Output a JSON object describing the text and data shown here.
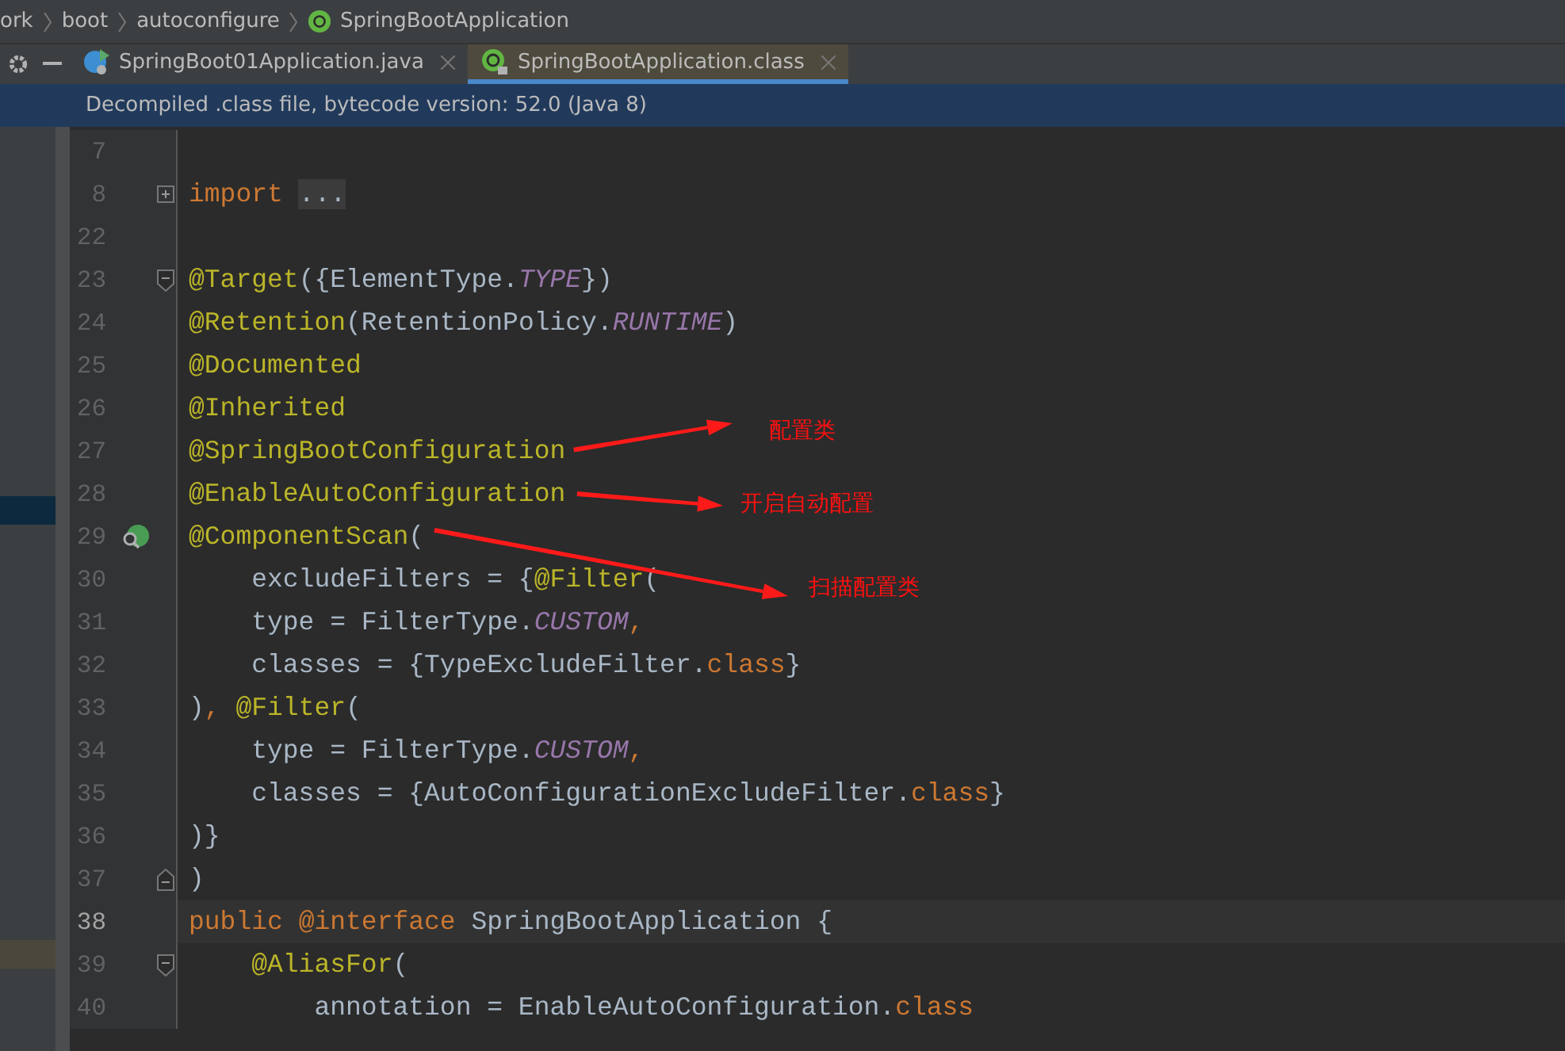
{
  "breadcrumbs": [
    {
      "label": "ork",
      "icon": false
    },
    {
      "label": "boot",
      "icon": false
    },
    {
      "label": "autoconfigure",
      "icon": false
    },
    {
      "label": "SpringBootApplication",
      "icon": true
    }
  ],
  "tabs": [
    {
      "label": "SpringBoot01Application.java",
      "selected": false,
      "kind": "java"
    },
    {
      "label": "SpringBootApplication.class",
      "selected": true,
      "kind": "annotation"
    }
  ],
  "banner": "Decompiled .class file, bytecode version: 52.0 (Java 8)",
  "lines": [
    {
      "number": "7",
      "current": false,
      "gutter_icon": false
    },
    {
      "number": "8",
      "current": false,
      "gutter_icon": false,
      "fold": {
        "kind": "expand"
      },
      "tokens": [
        {
          "kind": "keyword",
          "text": "import"
        },
        {
          "kind": "folded",
          "text": "..."
        }
      ]
    },
    {
      "number": "22",
      "current": false,
      "gutter_icon": false
    },
    {
      "number": "23",
      "current": false,
      "gutter_icon": false,
      "fold": {
        "kind": "start"
      },
      "tokens": [
        {
          "kind": "annotation",
          "text": "@Target"
        },
        {
          "kind": "plain",
          "text": "({ElementType."
        },
        {
          "kind": "constant",
          "text": "TYPE"
        },
        {
          "kind": "plain",
          "text": "})"
        }
      ]
    },
    {
      "number": "24",
      "current": false,
      "gutter_icon": false,
      "tokens": [
        {
          "kind": "annotation",
          "text": "@Retention"
        },
        {
          "kind": "plain",
          "text": "(RetentionPolicy."
        },
        {
          "kind": "constant",
          "text": "RUNTIME"
        },
        {
          "kind": "plain",
          "text": ")"
        }
      ]
    },
    {
      "number": "25",
      "current": false,
      "gutter_icon": false,
      "tokens": [
        {
          "kind": "annotation",
          "text": "@Documented"
        }
      ]
    },
    {
      "number": "26",
      "current": false,
      "gutter_icon": false,
      "tokens": [
        {
          "kind": "annotation",
          "text": "@Inherited"
        }
      ]
    },
    {
      "number": "27",
      "current": false,
      "gutter_icon": false,
      "tokens": [
        {
          "kind": "annotation",
          "text": "@SpringBootConfiguration"
        }
      ]
    },
    {
      "number": "28",
      "current": false,
      "gutter_icon": false,
      "tokens": [
        {
          "kind": "annotation",
          "text": "@EnableAutoConfiguration"
        }
      ]
    },
    {
      "number": "29",
      "current": false,
      "gutter_icon": true,
      "tokens": [
        {
          "kind": "annotation",
          "text": "@ComponentScan"
        },
        {
          "kind": "plain",
          "text": "("
        }
      ]
    },
    {
      "number": "30",
      "current": false,
      "gutter_icon": false,
      "tokens": [
        {
          "kind": "plain",
          "text": "    excludeFilters = {"
        },
        {
          "kind": "annotation",
          "text": "@Filter"
        },
        {
          "kind": "plain",
          "text": "("
        }
      ]
    },
    {
      "number": "31",
      "current": false,
      "gutter_icon": false,
      "tokens": [
        {
          "kind": "plain",
          "text": "    type = FilterType."
        },
        {
          "kind": "constant",
          "text": "CUSTOM"
        },
        {
          "kind": "keyword",
          "text": ","
        }
      ]
    },
    {
      "number": "32",
      "current": false,
      "gutter_icon": false,
      "tokens": [
        {
          "kind": "plain",
          "text": "    classes = {TypeExcludeFilter."
        },
        {
          "kind": "keyword",
          "text": "class"
        },
        {
          "kind": "plain",
          "text": "}"
        }
      ]
    },
    {
      "number": "33",
      "current": false,
      "gutter_icon": false,
      "tokens": [
        {
          "kind": "plain",
          "text": ")"
        },
        {
          "kind": "keyword",
          "text": ", "
        },
        {
          "kind": "annotation",
          "text": "@Filter"
        },
        {
          "kind": "plain",
          "text": "("
        }
      ]
    },
    {
      "number": "34",
      "current": false,
      "gutter_icon": false,
      "tokens": [
        {
          "kind": "plain",
          "text": "    type = FilterType."
        },
        {
          "kind": "constant",
          "text": "CUSTOM"
        },
        {
          "kind": "keyword",
          "text": ","
        }
      ]
    },
    {
      "number": "35",
      "current": false,
      "gutter_icon": false,
      "tokens": [
        {
          "kind": "plain",
          "text": "    classes = {AutoConfigurationExcludeFilter."
        },
        {
          "kind": "keyword",
          "text": "class"
        },
        {
          "kind": "plain",
          "text": "}"
        }
      ]
    },
    {
      "number": "36",
      "current": false,
      "gutter_icon": false,
      "tokens": [
        {
          "kind": "plain",
          "text": ")}"
        }
      ]
    },
    {
      "number": "37",
      "current": false,
      "gutter_icon": false,
      "fold": {
        "kind": "end"
      },
      "tokens": [
        {
          "kind": "plain",
          "text": ")"
        }
      ]
    },
    {
      "number": "38",
      "current": true,
      "gutter_icon": false,
      "tokens": [
        {
          "kind": "keyword",
          "text": "public "
        },
        {
          "kind": "annotation-keyword",
          "text": "@interface"
        },
        {
          "kind": "plain",
          "text": " SpringBootApplication {"
        }
      ]
    },
    {
      "number": "39",
      "current": false,
      "gutter_icon": false,
      "fold": {
        "kind": "start"
      },
      "tokens": [
        {
          "kind": "annotation",
          "text": "    @AliasFor"
        },
        {
          "kind": "plain",
          "text": "("
        }
      ]
    },
    {
      "number": "40",
      "current": false,
      "gutter_icon": false,
      "tokens": [
        {
          "kind": "plain",
          "text": "        annotation = EnableAutoConfiguration."
        },
        {
          "kind": "keyword",
          "text": "class"
        }
      ]
    }
  ],
  "annotations": [
    {
      "text": "配置类"
    },
    {
      "text": "开启自动配置"
    },
    {
      "text": "扫描配置类"
    }
  ]
}
